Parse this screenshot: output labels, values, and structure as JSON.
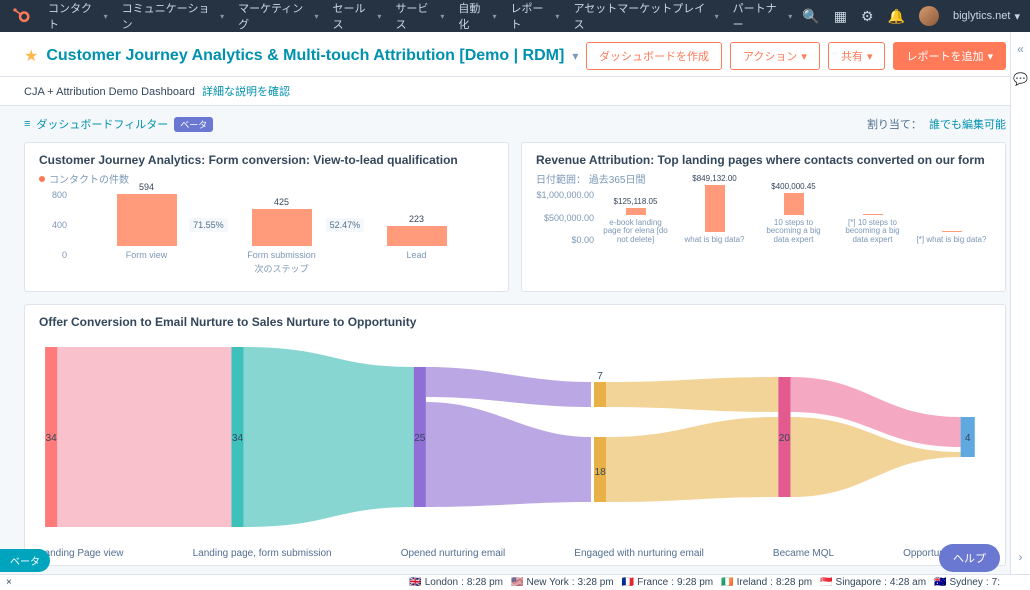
{
  "nav": {
    "items": [
      "コンタクト",
      "コミュニケーション",
      "マーケティング",
      "セールス",
      "サービス",
      "自動化",
      "レポート",
      "アセットマーケットプレイス",
      "パートナー"
    ],
    "account": "biglytics.net"
  },
  "header": {
    "title": "Customer Journey Analytics & Multi-touch Attribution [Demo | RDM]",
    "actions": {
      "create": "ダッシュボードを作成",
      "action": "アクション",
      "share": "共有",
      "add_report": "レポートを追加"
    }
  },
  "subheader": {
    "text": "CJA + Attribution Demo Dashboard",
    "link": "詳細な説明を確認"
  },
  "filterbar": {
    "label": "ダッシュボードフィルター",
    "badge": "ベータ",
    "assigned_label": "割り当て：",
    "assigned_link": "誰でも編集可能"
  },
  "chart_data": [
    {
      "id": "funnel",
      "type": "bar",
      "title": "Customer Journey Analytics: Form conversion: View-to-lead qualification",
      "legend": "コンタクトの件数",
      "categories": [
        "Form view",
        "Form submission",
        "Lead"
      ],
      "values": [
        594,
        425,
        223
      ],
      "conversions": [
        "71.55%",
        "52.47%"
      ],
      "ylim": [
        0,
        800
      ],
      "yticks": [
        0,
        400,
        800
      ],
      "xlabel": "次のステップ"
    },
    {
      "id": "revenue",
      "type": "bar",
      "title": "Revenue Attribution: Top landing pages where contacts converted on our form",
      "meta": "日付範囲： 過去365日間",
      "categories": [
        "e-book landing page for elena [do not delete]",
        "what is big data?",
        "10 steps to becoming a big data expert",
        "[*] 10 steps to becoming a big data expert",
        "[*] what is big data?"
      ],
      "labels": [
        "$125,118.05",
        "$849,132.00",
        "$400,000.45",
        "",
        ""
      ],
      "values": [
        125118.05,
        849132.0,
        400000.45,
        0,
        0
      ],
      "ylim": [
        0,
        1000000
      ],
      "yticks": [
        "$0.00",
        "$500,000.00",
        "$1,000,000.00"
      ]
    },
    {
      "id": "sankey",
      "type": "sankey",
      "title": "Offer Conversion to Email Nurture to Sales Nurture to Opportunity",
      "stages": [
        "Landing Page view",
        "Landing page, form submission",
        "Opened nurturing email",
        "Engaged with nurturing email",
        "Became MQL",
        "Opportunity created"
      ],
      "node_values": [
        34,
        34,
        25,
        7,
        18,
        20,
        4
      ]
    }
  ],
  "footer": {
    "clocks": [
      {
        "flag": "🇬🇧",
        "city": "London",
        "time": "8:28 pm"
      },
      {
        "flag": "🇺🇸",
        "city": "New York",
        "time": "3:28 pm"
      },
      {
        "flag": "🇫🇷",
        "city": "France",
        "time": "9:28 pm"
      },
      {
        "flag": "🇮🇪",
        "city": "Ireland",
        "time": "8:28 pm"
      },
      {
        "flag": "🇸🇬",
        "city": "Singapore",
        "time": "4:28 am"
      },
      {
        "flag": "🇦🇺",
        "city": "Sydney",
        "time": "7:"
      }
    ]
  },
  "help": "ヘルプ",
  "beta": "ベータ"
}
